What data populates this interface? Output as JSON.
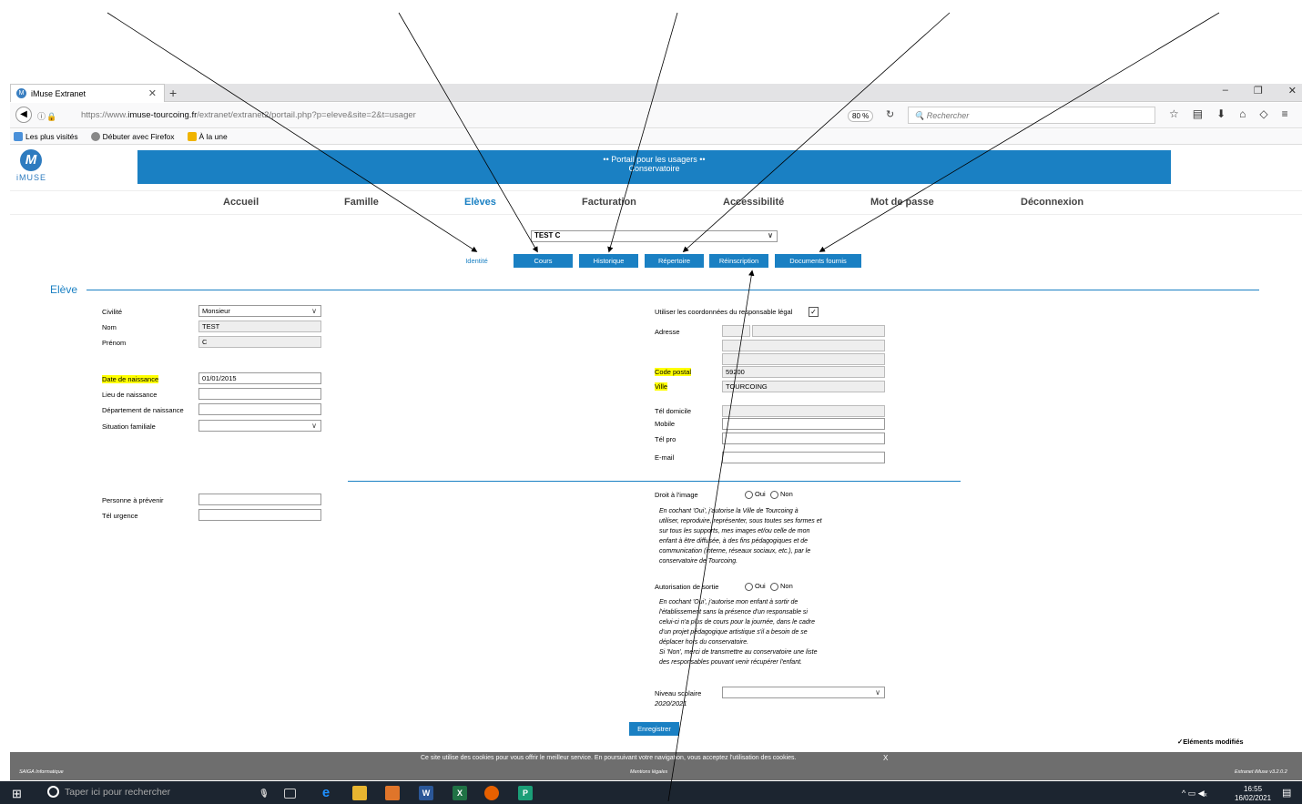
{
  "browser": {
    "tab_title": "iMuse Extranet",
    "url_prefix": "https://www.",
    "url_host": "imuse-tourcoing.fr",
    "url_path": "/extranet/extranet2/portail.php?p=eleve&site=2&t=usager",
    "zoom": "80 %",
    "search_placeholder": "Rechercher",
    "bookmarks": [
      "Les plus visités",
      "Débuter avec Firefox",
      "À la une"
    ]
  },
  "header": {
    "logo_text": "iMUSE",
    "banner_line1": "•• Portail pour les usagers ••",
    "banner_line2": "Conservatoire"
  },
  "menu": [
    "Accueil",
    "Famille",
    "Elèves",
    "Facturation",
    "Accessibilité",
    "Mot de passe",
    "Déconnexion"
  ],
  "student_select": "TEST C",
  "tabs": [
    "Identité",
    "Cours",
    "Historique",
    "Répertoire",
    "Réinscription",
    "Documents fournis"
  ],
  "section_title": "Elève",
  "left": {
    "civilite_label": "Civilité",
    "civilite": "Monsieur",
    "nom_label": "Nom",
    "nom": "TEST",
    "prenom_label": "Prénom",
    "prenom": "C",
    "dob_label": "Date de naissance",
    "dob": "01/01/2015",
    "lieu_label": "Lieu de naissance",
    "dept_label": "Département de naissance",
    "situation_label": "Situation familiale",
    "prevenir_label": "Personne à prévenir",
    "tel_urgence_label": "Tél urgence"
  },
  "right": {
    "use_resp_label": "Utiliser les coordonnées du responsable légal",
    "checkmark": "✓",
    "adresse_label": "Adresse",
    "cp_label": "Code postal",
    "cp": "59200",
    "ville_label": "Ville",
    "ville": "TOURCOING",
    "tel_dom_label": "Tél domicile",
    "mobile_label": "Mobile",
    "tel_pro_label": "Tél pro",
    "email_label": "E-mail",
    "droit_label": "Droit à l'image",
    "oui": "Oui",
    "non": "Non",
    "droit_text": [
      "En cochant 'Oui', j'autorise la Ville de Tourcoing à",
      "utiliser, reproduire, représenter, sous toutes ses formes et",
      "sur tous les supports, mes images et/ou celle de mon",
      "enfant à être diffusée, à des fins pédagogiques et de",
      "communication (interne, réseaux sociaux, etc.), par le",
      "conservatoire de Tourcoing."
    ],
    "sortie_label": "Autorisation de sortie",
    "sortie_text": [
      "En cochant 'Oui', j'autorise mon enfant à sortir de",
      "l'établissement sans la présence d'un responsable si",
      "celui-ci n'a plus de cours pour la journée, dans le cadre",
      "d'un projet pédagogique artistique s'il a besoin de se",
      "déplacer hors du conservatoire.",
      "Si 'Non', merci de transmettre au conservatoire une liste",
      "des responsables pouvant venir récupérer l'enfant."
    ],
    "niveau_label1": "Niveau scolaire",
    "niveau_label2": "2020/2021"
  },
  "save_label": "Enregistrer",
  "modified_label": "✓Eléments modifiés",
  "footer": {
    "cookie": "Ce site utilise des cookies pour vous offrir le meilleur service. En poursuivant votre navigation, vous acceptez l'utilisation des cookies.",
    "close": "X",
    "company": "SAIGA Informatique",
    "mentions": "Mentions légales",
    "version": "Extranet iMuse v3.2.0.2"
  },
  "taskbar": {
    "search": "Taper ici pour rechercher",
    "time": "16:55",
    "date": "16/02/2021"
  }
}
